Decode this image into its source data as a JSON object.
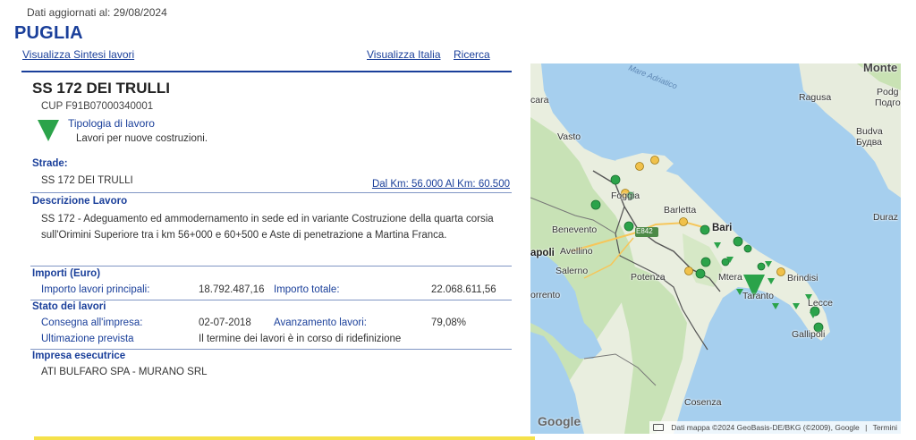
{
  "header": {
    "updated": "Dati aggiornati al: 29/08/2024",
    "region": "PUGLIA",
    "links": {
      "sintesi": "Visualizza Sintesi lavori",
      "italia": "Visualizza Italia",
      "ricerca": "Ricerca"
    }
  },
  "project": {
    "title": "SS 172 DEI TRULLI",
    "cup": "CUP F91B07000340001",
    "icon": "green-triangle-icon",
    "icon_color": "#2ba34a",
    "tipologia_label": "Tipologia di lavoro",
    "tipologia_value": "Lavori per nuove costruzioni."
  },
  "strade": {
    "heading": "Strade:",
    "value": "SS 172 DEI TRULLI",
    "km_link": "Dal Km: 56.000 Al Km: 60.500"
  },
  "descrizione": {
    "heading": "Descrizione Lavoro",
    "text": "SS 172 - Adeguamento ed ammodernamento in sede ed in variante Costruzione della quarta corsia sull'Orimini Superiore tra i km 56+000 e 60+500 e Aste di penetrazione a Martina Franca."
  },
  "importi": {
    "heading": "Importi (Euro)",
    "principali_label": "Importo lavori principali:",
    "principali_value": "18.792.487,16",
    "totale_label": "Importo totale:",
    "totale_value": "22.068.611,56"
  },
  "stato": {
    "heading": "Stato dei lavori",
    "consegna_label": "Consegna all'impresa:",
    "consegna_value": "02-07-2018",
    "avanzamento_label": "Avanzamento lavori:",
    "avanzamento_value": "79,08%",
    "ultimazione_label": "Ultimazione prevista",
    "ultimazione_value": "Il termine dei lavori è in corso di ridefinizione"
  },
  "impresa": {
    "heading": "Impresa esecutrice",
    "value": "ATI BULFARO SPA - MURANO SRL"
  },
  "map": {
    "sea_label": "Mare Adriatico",
    "labels": {
      "montenegro": "Monte",
      "cara": "cara",
      "ragusa": "Ragusa",
      "podg1": "Podg",
      "podg2": "Подго",
      "vasto": "Vasto",
      "budva1": "Budva",
      "budva2": "Будва",
      "foggia": "Foggia",
      "barletta": "Barletta",
      "bari": "Bari",
      "durazzo": "Duraz",
      "benevento": "Benevento",
      "avellino": "Avellino",
      "napoli": "apoli",
      "salerno": "Salerno",
      "sorrento": "orrento",
      "potenza": "Potenza",
      "matera": "Mtera",
      "brindisi": "Brindisi",
      "taranto": "Taranto",
      "lecce": "Lecce",
      "gallipoli": "Gallipoli",
      "cosenza": "Cosenza",
      "e842": "E842"
    },
    "google": "Google",
    "attribution": "Dati mappa ©2024 GeoBasis-DE/BKG (©2009), Google",
    "terms": "Termini",
    "colors": {
      "sea": "#a6cfee",
      "land": "#e9eedf",
      "green_land": "#c8e2b6",
      "green_marker": "#2ba34a",
      "yellow_marker": "#f0c14b"
    }
  }
}
